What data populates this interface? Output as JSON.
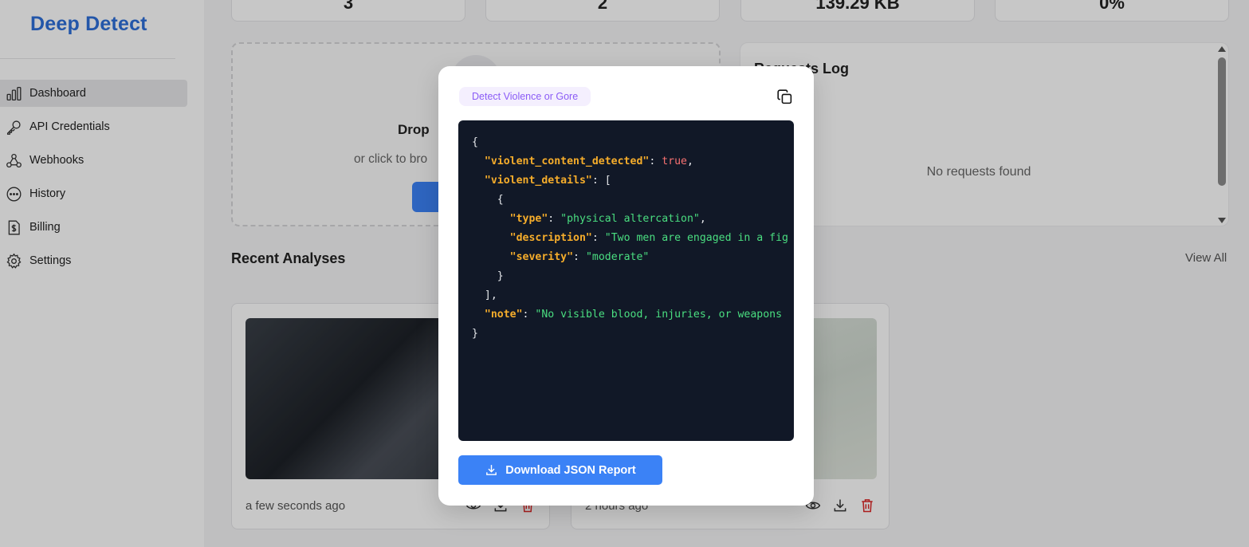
{
  "app": {
    "brand": "Deep Detect"
  },
  "sidebar": {
    "items": [
      {
        "label": "Dashboard",
        "icon": "bar-chart-icon",
        "active": true
      },
      {
        "label": "API Credentials",
        "icon": "key-icon",
        "active": false
      },
      {
        "label": "Webhooks",
        "icon": "webhook-icon",
        "active": false
      },
      {
        "label": "History",
        "icon": "history-icon",
        "active": false
      },
      {
        "label": "Billing",
        "icon": "billing-icon",
        "active": false
      },
      {
        "label": "Settings",
        "icon": "gear-icon",
        "active": false
      }
    ]
  },
  "stats": {
    "card1": "3",
    "card2": "2",
    "card3": "139.29 KB",
    "card4": "0%"
  },
  "upload": {
    "title": "Drop",
    "subtitle": "or click to bro"
  },
  "requests_log": {
    "title": "Requests Log",
    "empty": "No requests found"
  },
  "recent": {
    "title": "Recent Analyses",
    "view_all": "View All",
    "cards": [
      {
        "time": "a few seconds ago"
      },
      {
        "time": "2 hours ago"
      }
    ]
  },
  "modal": {
    "badge": "Detect Violence or Gore",
    "download_label": "Download JSON Report",
    "json": {
      "violent_content_detected_key": "\"violent_content_detected\"",
      "violent_content_detected_val": "true",
      "violent_details_key": "\"violent_details\"",
      "type_key": "\"type\"",
      "type_val": "\"physical altercation\"",
      "description_key": "\"description\"",
      "description_val": "\"Two men are engaged in a fig",
      "severity_key": "\"severity\"",
      "severity_val": "\"moderate\"",
      "note_key": "\"note\"",
      "note_val": "\"No visible blood, injuries, or weapons"
    }
  },
  "colors": {
    "brand": "#2e6fd9",
    "primary_button": "#3b82f6",
    "badge_text": "#8b5cf6",
    "code_bg": "#111827",
    "json_key": "#f6ad2b",
    "json_string": "#4ade80",
    "json_bool": "#f87171",
    "delete": "#dc2626"
  }
}
